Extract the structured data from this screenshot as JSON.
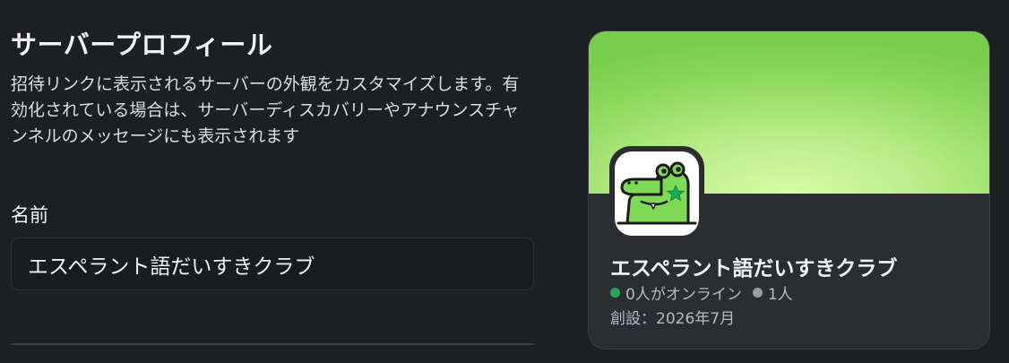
{
  "profile": {
    "title": "サーバープロフィール",
    "description": "招待リンクに表示されるサーバーの外観をカスタマイズします。有効化されている場合は、サーバーディスカバリーやアナウンスチャンネルのメッセージにも表示されます",
    "name_label": "名前",
    "name_value": "エスペラント語だいすきクラブ"
  },
  "preview": {
    "server_name": "エスペラント語だいすきクラブ",
    "online_text": "0人がオンライン",
    "members_text": "1人",
    "founded_text": "創設：2026年7月",
    "avatar_icon": "green-crocodile-star",
    "colors": {
      "banner": "#8ed95e",
      "online": "#23a55a",
      "card_bg": "#2b2d31"
    }
  }
}
